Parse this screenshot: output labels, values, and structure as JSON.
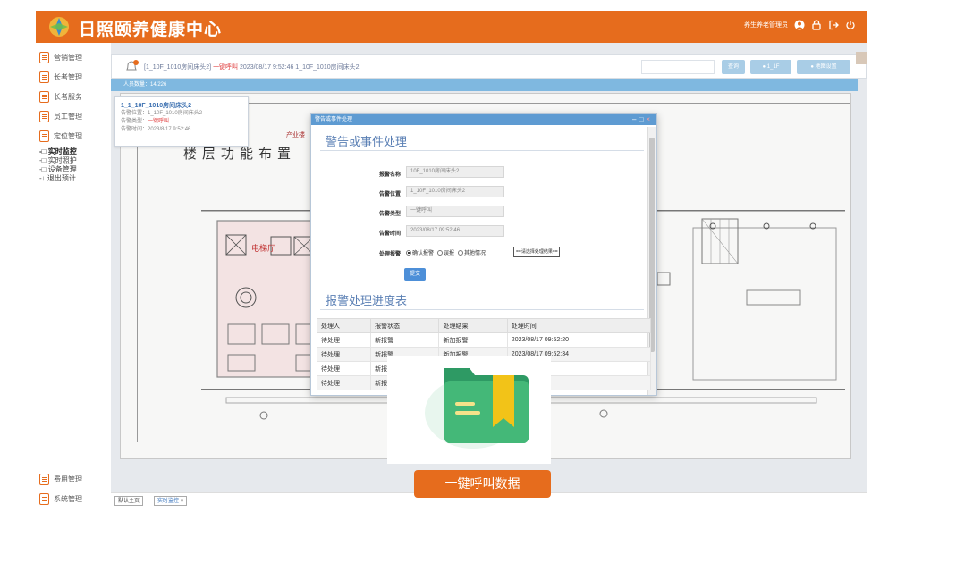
{
  "header": {
    "title": "日照颐养健康中心",
    "user_label": "养生养老管理员"
  },
  "sidebar": {
    "items": [
      {
        "label": "营销管理"
      },
      {
        "label": "长者管理"
      },
      {
        "label": "长者服务"
      },
      {
        "label": "员工管理"
      },
      {
        "label": "定位管理"
      }
    ],
    "subitems": [
      {
        "label": "-□ 实时监控",
        "active": true
      },
      {
        "label": "-□ 实时照护"
      },
      {
        "label": "-□ 设备管理"
      },
      {
        "label": "-↓ 退出预计"
      }
    ],
    "bottom_items": [
      {
        "label": "费用管理"
      },
      {
        "label": "系统管理"
      }
    ]
  },
  "toolbar": {
    "ticker_prefix": "[1_10F_1010房间床头2]",
    "ticker_alert": "一键呼叫",
    "ticker_rest": "2023/08/17 9:52:46 1_10F_1010房间床头2",
    "btn_search": "查询",
    "btn_locate": "1_1F",
    "btn_map": "地图设置"
  },
  "info_bar": "人员数量：14/226",
  "alarm_card": {
    "title": "1_1_10F_1010房间床头2",
    "line1": "告警位置：1_10F_1010房间床头2",
    "line2_label": "告警类型：",
    "line2_value": "一键呼叫",
    "line3": "告警时间：2023/8/17 9:52:46"
  },
  "dialog": {
    "window_title": "警告或事件处理",
    "section1": "警告或事件处理",
    "fields": [
      {
        "label": "报警名称",
        "value": "10F_1010房间床头2"
      },
      {
        "label": "告警位置",
        "value": "1_10F_1010房间床头2"
      },
      {
        "label": "告警类型",
        "value": "一键呼叫"
      },
      {
        "label": "告警时间",
        "value": "2023/08/17 09:52:46"
      }
    ],
    "process_label": "处理报警",
    "radio_confirm": "确认报警",
    "radio_false": "误报",
    "radio_other": "其他情况",
    "select_placeholder": "==请选择处理结果==",
    "submit": "提交",
    "section2": "报警处理进度表",
    "table": {
      "headers": [
        "处理人",
        "报警状态",
        "处理结果",
        "处理时间"
      ],
      "rows": [
        [
          "待处理",
          "新报警",
          "新加报警",
          "2023/08/17 09:52:20"
        ],
        [
          "待处理",
          "新报警",
          "新加报警",
          "2023/08/17 09:52:34"
        ],
        [
          "待处理",
          "新报",
          "",
          ""
        ],
        [
          "待处理",
          "新报",
          "",
          ""
        ]
      ]
    }
  },
  "tabs": [
    {
      "label": "默认主页"
    },
    {
      "label": "实时监控"
    }
  ],
  "overlay": {
    "caption": "一键呼叫数据"
  },
  "floorplan": {
    "title": "楼层功能布置",
    "room_label": "电梯厅"
  },
  "colors": {
    "brand": "#e66c1d",
    "accent": "#5e9bd2",
    "folder": "#2fa36b",
    "ribbon": "#f2c318"
  }
}
